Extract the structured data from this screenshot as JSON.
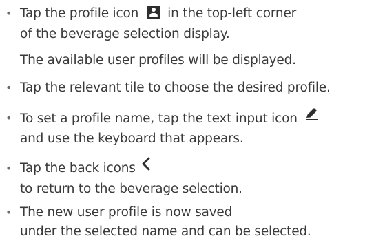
{
  "instructions": [
    {
      "lines": [
        "Tap the profile icon",
        "in the top-left corner",
        "of the beverage selection display.",
        "The available user profiles will be displayed."
      ],
      "icon": "profile-icon"
    },
    {
      "lines": [
        "Tap the relevant tile to choose the desired profile."
      ]
    },
    {
      "lines": [
        "To set a profile name, tap the text input icon",
        "and use the keyboard that appears."
      ],
      "icon": "pencil-edit-icon"
    },
    {
      "lines": [
        "Tap the back icons",
        "to return to the beverage selection."
      ],
      "icon": "chevron-left-icon"
    },
    {
      "lines": [
        "The new user profile is now saved",
        "under the selected name and can be selected."
      ]
    }
  ],
  "bullet": "•",
  "colors": {
    "text": "#3a3a3a",
    "icon": "#2e2e2e"
  }
}
